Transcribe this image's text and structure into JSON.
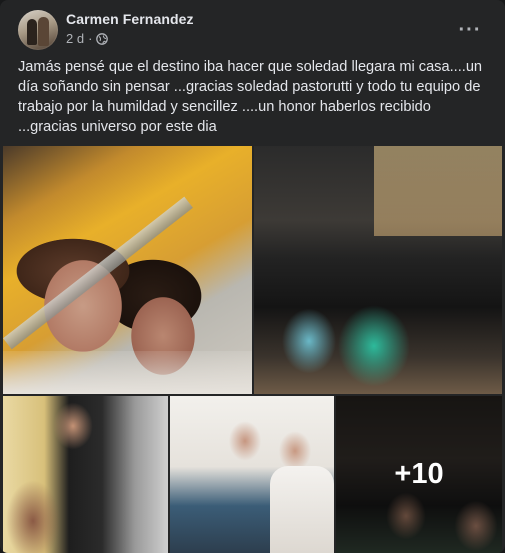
{
  "post": {
    "author": "Carmen Fernandez",
    "time": "2 d",
    "separator": "·",
    "audience_icon": "globe-icon",
    "more_label": "···",
    "caption": "Jamás pensé que el destino iba hacer que soledad llegara mi casa....un día soñando sin pensar ...gracias soledad pastorutti y todo tu equipo de trabajo por la humildad y sencillez ....un honor haberlos recibido ...gracias universo por este dia",
    "photos": [
      {
        "name": "selfie-photo"
      },
      {
        "name": "group-photo"
      },
      {
        "name": "living-room-photo"
      },
      {
        "name": "couple-photo"
      },
      {
        "name": "crowd-photo"
      }
    ],
    "more_photos": "+10"
  },
  "colors": {
    "background": "#242526",
    "primary_text": "#e4e6eb",
    "secondary_text": "#b0b3b8"
  }
}
